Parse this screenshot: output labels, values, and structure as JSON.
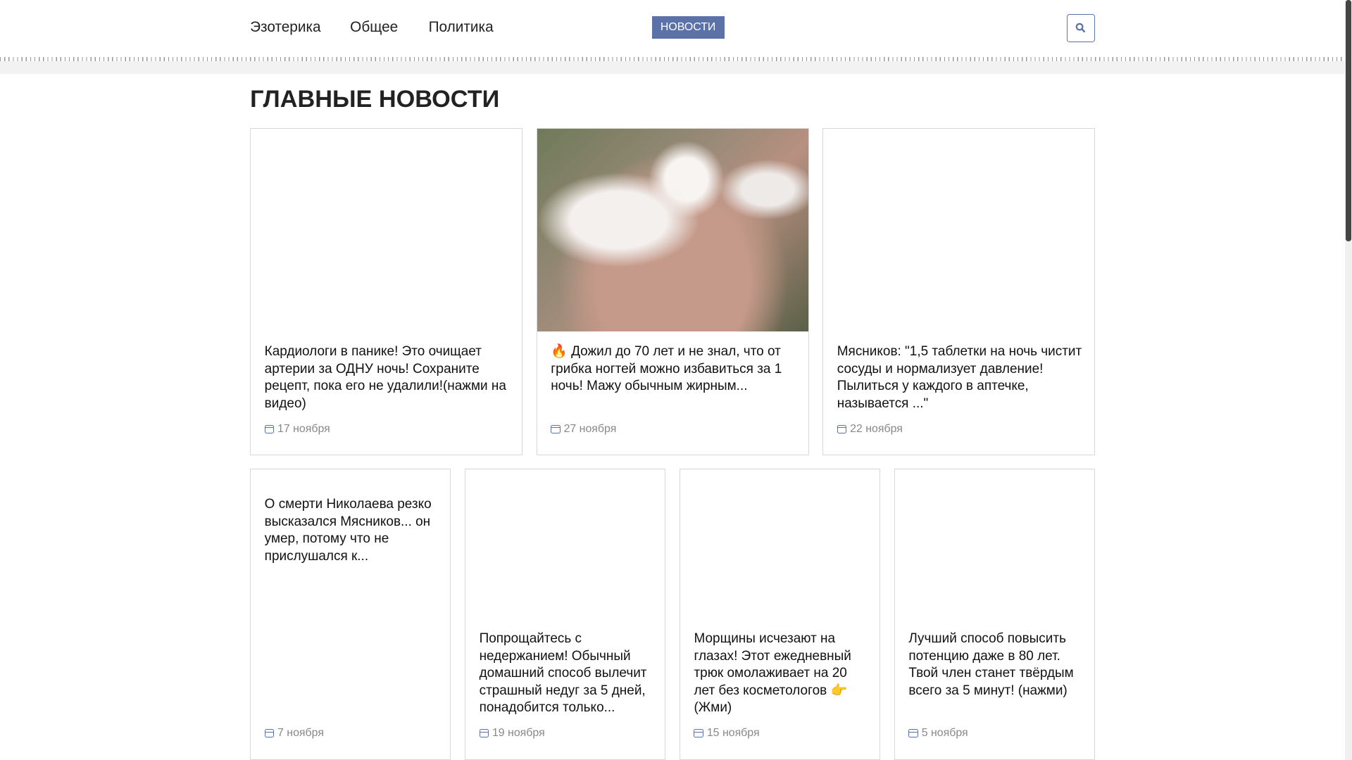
{
  "nav": {
    "items": [
      "Эзотерика",
      "Общее",
      "Политика"
    ],
    "news_button": "НОВОСТИ"
  },
  "heading": "ГЛАВНЫЕ НОВОСТИ",
  "cards": [
    {
      "title": "Кардиологи в панике! Это очищает артерии за ОДНУ ночь! Сохраните рецепт, пока его не удалили!(нажми на видео)",
      "date": "17 ноября"
    },
    {
      "title": "🔥 Дожил до 70 лет и не знал, что от грибка ногтей можно избавиться за 1 ночь! Мажу обычным жирным...",
      "date": "27 ноября"
    },
    {
      "title": "Мясников: \"1,5 таблетки на ночь чистит сосуды и нормализует давление! Пылиться у каждого в аптечке, называется ...\"",
      "date": "22 ноября"
    },
    {
      "title": "О смерти Николаева резко высказался Мясников... он умер, потому что не прислушался к...",
      "date": "7 ноября"
    },
    {
      "title": "Попрощайтесь с недержанием! Обычный домашний способ вылечит страшный недуг за 5 дней, понадобится только...",
      "date": "19 ноября"
    },
    {
      "title": "Морщины исчезают на глазах! Этот ежедневный трюк омолаживает на 20 лет без косметологов 👉 (Жми)",
      "date": "15 ноября"
    },
    {
      "title": "Лучший способ повысить потенцию даже в 80 лет. Твой член станет твёрдым всего за 5 минут! (нажми)",
      "date": "5 ноября"
    }
  ]
}
